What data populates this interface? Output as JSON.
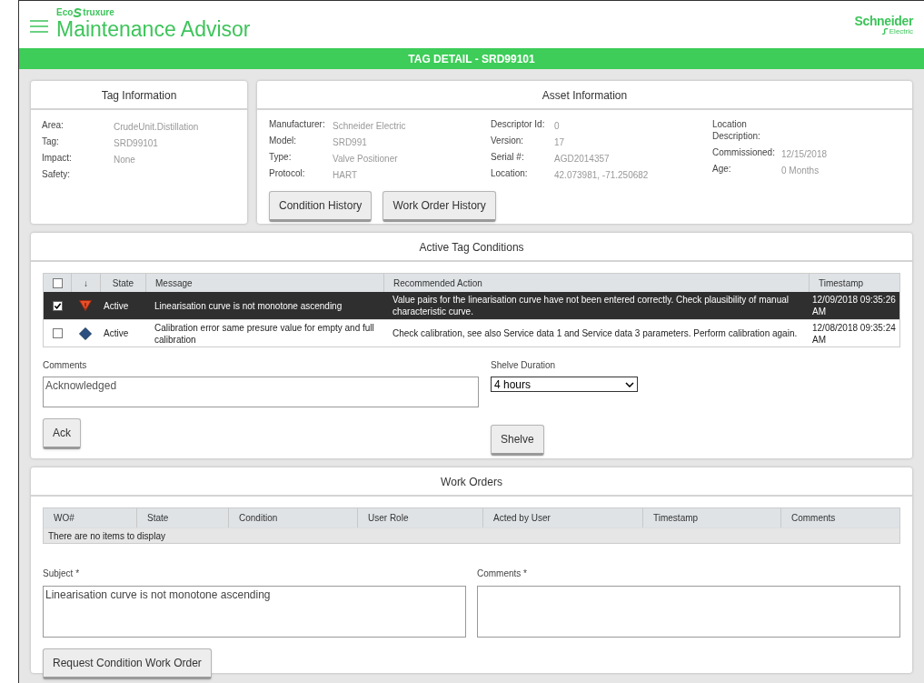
{
  "header": {
    "brand_prefix": "Eco",
    "brand_suffix": "truxure",
    "app_title": "Maintenance Advisor",
    "company": "Schneider",
    "company_sub": "Electric"
  },
  "banner": "TAG DETAIL - SRD99101",
  "tag_info": {
    "title": "Tag Information",
    "fields": [
      {
        "label": "Area:",
        "value": "CrudeUnit.Distillation"
      },
      {
        "label": "Tag:",
        "value": "SRD99101"
      },
      {
        "label": "Impact:",
        "value": "None"
      },
      {
        "label": "Safety:"
      }
    ]
  },
  "asset_info": {
    "title": "Asset Information",
    "columns": [
      [
        {
          "label": "Manufacturer:",
          "value": "Schneider Electric"
        },
        {
          "label": "Model:",
          "value": "SRD991"
        },
        {
          "label": "Type:",
          "value": "Valve Positioner"
        },
        {
          "label": "Protocol:",
          "value": "HART"
        }
      ],
      [
        {
          "label": "Descriptor Id:",
          "value": "0"
        },
        {
          "label": "Version:",
          "value": "17"
        },
        {
          "label": "Serial #:",
          "value": "AGD2014357"
        },
        {
          "label": "Location:",
          "value": "42.073981, -71.250682"
        }
      ],
      [
        {
          "label": "Location Description:"
        },
        {
          "label": "Commissioned:",
          "value": "12/15/2018"
        },
        {
          "label": "Age:",
          "value": "0 Months"
        }
      ]
    ],
    "buttons": [
      "Condition History",
      "Work Order History"
    ]
  },
  "conditions": {
    "title": "Active Tag Conditions",
    "columns": [
      "↓",
      "State",
      "Message",
      "Recommended Action",
      "Timestamp"
    ],
    "all_checked": false,
    "rows": [
      {
        "selected": true,
        "checked": true,
        "kind": "warning",
        "state": "Active",
        "message": "Linearisation curve is not monotone ascending",
        "action": "Value pairs for the linearisation curve have not been entered correctly. Check plausibility of manual characteristic curve.",
        "timestamp": "12/09/2018 09:35:26 AM"
      },
      {
        "selected": false,
        "checked": false,
        "kind": "info",
        "state": "Active",
        "message": "Calibration error same presure value for empty and full calibration",
        "action": "Check calibration, see also Service data 1 and Service data 3 parameters. Perform calibration again.",
        "timestamp": "12/08/2018 09:35:24 AM"
      }
    ],
    "comments_label": "Comments",
    "comments_value": "Acknowledged",
    "ack_button": "Ack",
    "shelve_label": "Shelve Duration",
    "shelve_value": "4 hours",
    "shelve_button": "Shelve"
  },
  "work_orders": {
    "title": "Work Orders",
    "columns": [
      "WO#",
      "State",
      "Condition",
      "User Role",
      "Acted by User",
      "Timestamp",
      "Comments"
    ],
    "empty_text": "There are no items to display",
    "subject_label": "Subject *",
    "subject_value": "Linearisation curve is not monotone ascending",
    "comments_label": "Comments *",
    "button": "Request Condition Work Order"
  }
}
